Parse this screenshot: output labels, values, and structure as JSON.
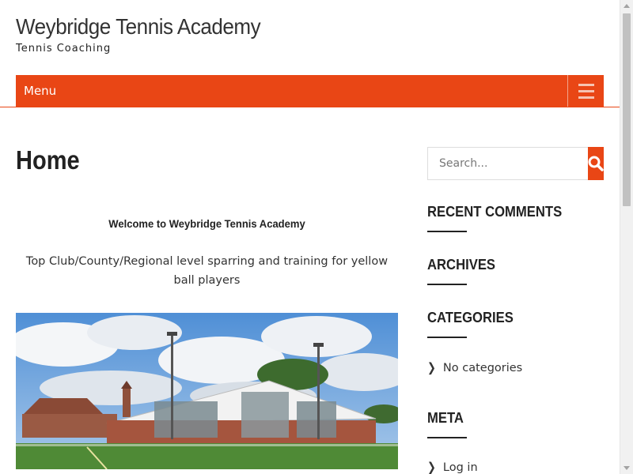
{
  "site": {
    "title": "Weybridge Tennis Academy",
    "description": "Tennis Coaching"
  },
  "nav": {
    "menu_label": "Menu",
    "toggle_icon": "hamburger-icon"
  },
  "page": {
    "title": "Home",
    "welcome": "Welcome to Weybridge Tennis Academy",
    "lead": "Top Club/County/Regional level sparring and training for yellow ball players"
  },
  "sidebar": {
    "search": {
      "placeholder": "Search...",
      "icon": "search-icon"
    },
    "recent_comments_title": "RECENT COMMENTS",
    "archives_title": "ARCHIVES",
    "categories_title": "CATEGORIES",
    "categories_item": "No categories",
    "meta_title": "META",
    "meta_item": "Log in"
  },
  "colors": {
    "accent": "#e94615",
    "text": "#222222"
  }
}
